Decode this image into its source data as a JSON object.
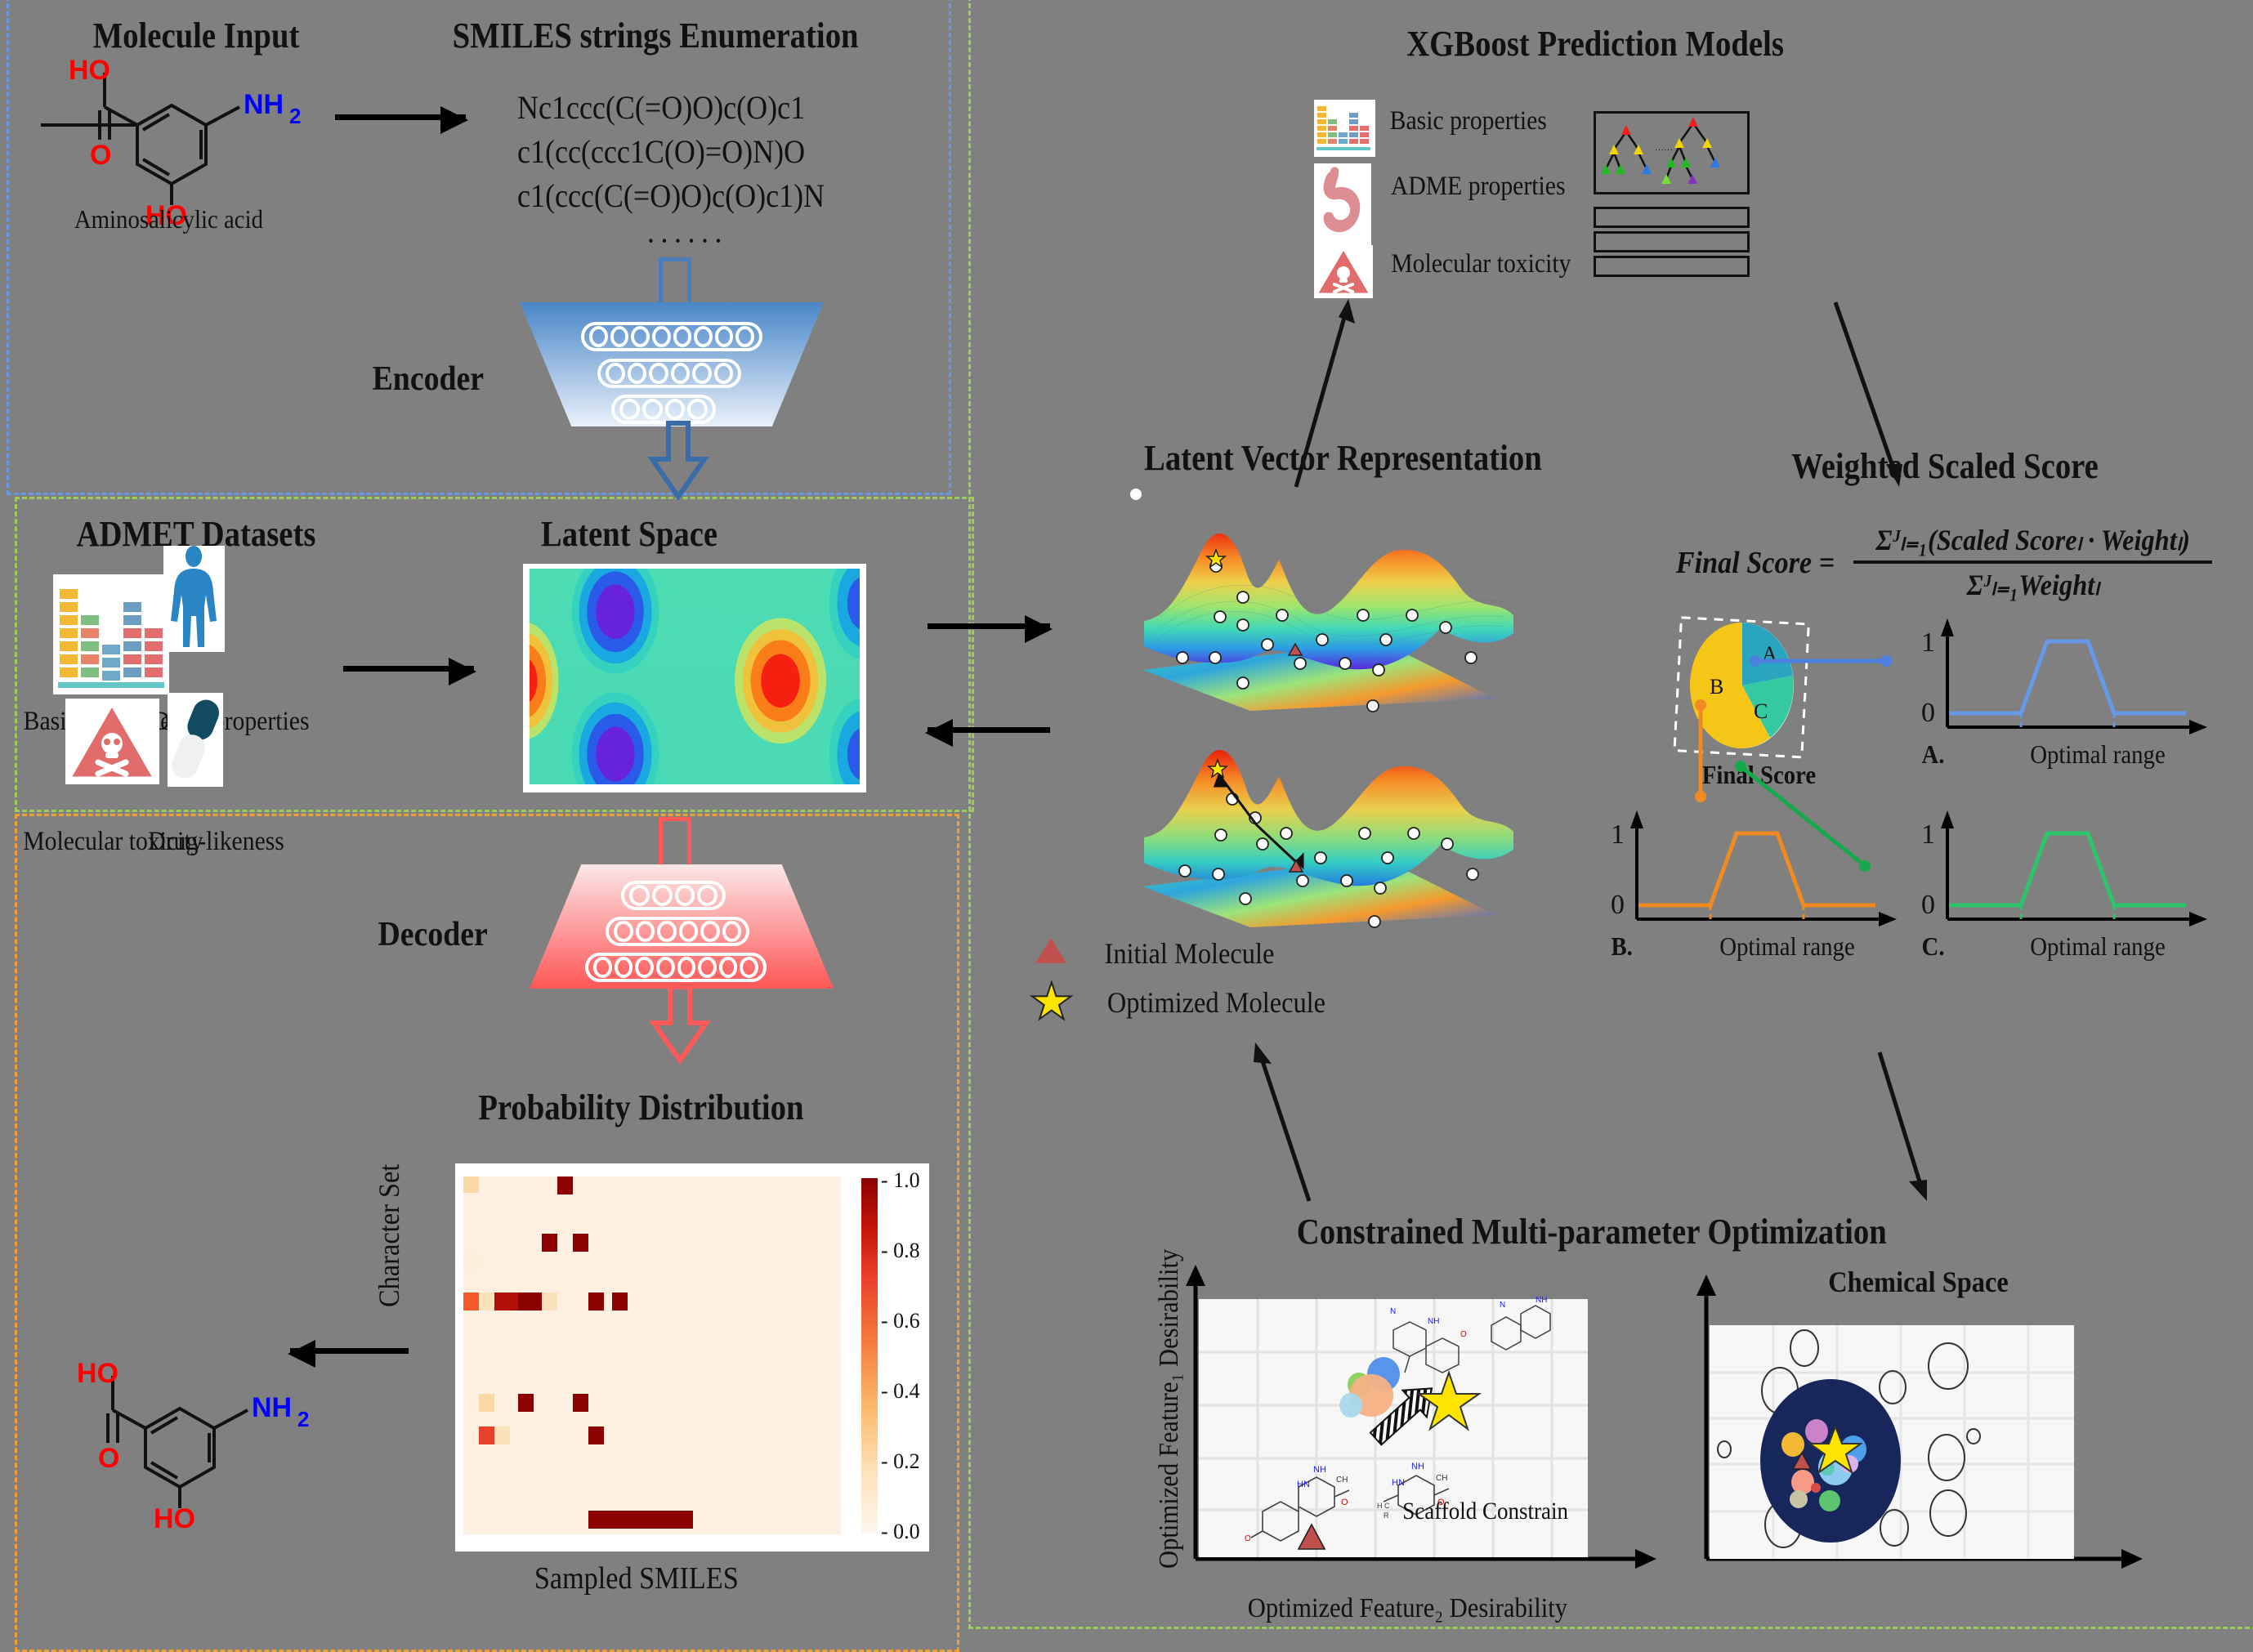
{
  "background_color": "#808080",
  "panels": {
    "molecule_input": {
      "title": "Molecule Input",
      "molecule_name": "Aminosalicylic acid",
      "atom_labels": [
        "HO",
        "O",
        "HO",
        "NH2"
      ],
      "border_color": "#6699e8"
    },
    "smiles_enumeration": {
      "title": "SMILES strings Enumeration",
      "strings": [
        "Nc1ccc(C(=O)O)c(O)c1",
        "c1(cc(ccc1C(O)=O)N)O",
        "c1(ccc(C(=O)O)c(O)c1)N"
      ],
      "ellipsis": "······"
    },
    "encoder": {
      "label": "Encoder",
      "layer_sizes": [
        8,
        6,
        4
      ],
      "color": "#4a7ebb"
    },
    "admet_datasets": {
      "title": "ADMET Datasets",
      "items": [
        {
          "label": "Basic properties",
          "icon": "bar-chart-icon"
        },
        {
          "label": "ADME properties",
          "icon": "human-body-icon"
        },
        {
          "label": "Molecular toxicity",
          "icon": "toxic-hazard-icon"
        },
        {
          "label": "Drug-likeness",
          "icon": "capsule-pill-icon"
        }
      ],
      "border_color": "#9acd5a"
    },
    "latent_space": {
      "title": "Latent Space"
    },
    "decoder": {
      "label": "Decoder",
      "layer_sizes": [
        4,
        6,
        8
      ],
      "color": "#ff5a5a",
      "border_color": "#f0a030"
    },
    "probability_distribution": {
      "title": "Probability Distribution",
      "ylabel": "Character Set",
      "xlabel": "Sampled SMILES"
    },
    "latent_vector": {
      "title": "Latent Vector Representation",
      "legend": [
        {
          "symbol": "triangle",
          "label": "Initial Molecule",
          "color": "#c0504d"
        },
        {
          "symbol": "star",
          "label": "Optimized Molecule",
          "color": "#ffe400"
        }
      ]
    },
    "xgboost": {
      "title": "XGBoost Prediction Models",
      "items": [
        {
          "label": "Basic properties",
          "icon": "bar-chart-icon"
        },
        {
          "label": "ADME properties",
          "icon": "stomach-icon"
        },
        {
          "label": "Molecular toxicity",
          "icon": "toxic-hazard-icon"
        }
      ],
      "tree_ellipsis": "······"
    },
    "weighted_scaled_score": {
      "title": "Weighted Scaled Score",
      "formula_lhs": "Final Score =",
      "formula_numerator": "Σᴶₗ₌₁(Scaled Scoreₗ · Weightₗ)",
      "formula_denominator": "Σᴶₗ₌₁Weightₗ",
      "pie_label": "Final Score",
      "pie_slices": [
        {
          "name": "A",
          "color": "#2aa5c0",
          "value": 25
        },
        {
          "name": "B",
          "color": "#f5c518",
          "value": 50
        },
        {
          "name": "C",
          "color": "#35c9a2",
          "value": 25
        }
      ],
      "subplots": [
        {
          "id": "A.",
          "xlabel": "Optimal range",
          "ytop": "1",
          "ybottom": "0",
          "color": "#6699e8"
        },
        {
          "id": "B.",
          "xlabel": "Optimal range",
          "ytop": "1",
          "ybottom": "0",
          "color": "#f08a22"
        },
        {
          "id": "C.",
          "xlabel": "Optimal range",
          "ytop": "1",
          "ybottom": "0",
          "color": "#2ec46a"
        }
      ]
    },
    "cmpo": {
      "title": "Constrained Multi-parameter Optimization",
      "left_plot": {
        "ylabel": "Optimized Feature₁  Desirability",
        "xlabel": "Optimized Feature₂  Desirability",
        "annotation": "Scaffold Constrain"
      },
      "right_plot": {
        "title": "Chemical  Space"
      },
      "border_color": "#9acd5a"
    }
  },
  "chart_data": [
    {
      "type": "heatmap",
      "title": "Probability Distribution",
      "xlabel": "Sampled SMILES",
      "ylabel": "Character Set",
      "colorbar_ticks": [
        "1.0",
        "0.8",
        "0.6",
        "0.4",
        "0.2",
        "0.0"
      ],
      "colorbar_range": [
        0.0,
        1.0
      ],
      "colormap": "OrRd",
      "cells": [
        {
          "col": 0,
          "row": 0,
          "value": 0.35
        },
        {
          "col": 6,
          "row": 0,
          "value": 1.0
        },
        {
          "col": 5,
          "row": 3,
          "value": 1.0
        },
        {
          "col": 7,
          "row": 3,
          "value": 1.0
        },
        {
          "col": 0,
          "row": 4,
          "value": 0.15
        },
        {
          "col": 0,
          "row": 7,
          "value": 0.62
        },
        {
          "col": 1,
          "row": 7,
          "value": 0.2
        },
        {
          "col": 2,
          "row": 7,
          "value": 0.93
        },
        {
          "col": 3,
          "row": 7,
          "value": 1.0
        },
        {
          "col": 4,
          "row": 7,
          "value": 0.22
        },
        {
          "col": 8,
          "row": 7,
          "value": 1.0
        },
        {
          "col": 10,
          "row": 7,
          "value": 1.0
        },
        {
          "col": 1,
          "row": 12,
          "value": 0.3
        },
        {
          "col": 4,
          "row": 12,
          "value": 1.0
        },
        {
          "col": 9,
          "row": 12,
          "value": 1.0
        },
        {
          "col": 1,
          "row": 14,
          "value": 0.7
        },
        {
          "col": 2,
          "row": 14,
          "value": 0.25
        },
        {
          "col": 11,
          "row": 14,
          "value": 1.0
        },
        {
          "col": 11,
          "row": 18,
          "value": 1.0
        }
      ]
    },
    {
      "type": "pie",
      "title": "Final Score",
      "labels": [
        "A",
        "B",
        "C"
      ],
      "values": [
        25,
        50,
        25
      ],
      "colors": [
        "#2aa5c0",
        "#f5c518",
        "#35c9a2"
      ]
    },
    {
      "type": "line",
      "title": "A.",
      "xlabel": "Optimal range",
      "ylabel": "",
      "ytick_labels": [
        "0",
        "1"
      ],
      "ylim": [
        0,
        1
      ],
      "color": "#6699e8",
      "x": [
        0.0,
        0.28,
        0.42,
        0.72,
        0.86,
        1.0
      ],
      "y": [
        0,
        0,
        1,
        1,
        0,
        0
      ]
    },
    {
      "type": "line",
      "title": "B.",
      "xlabel": "Optimal range",
      "ylabel": "",
      "ytick_labels": [
        "0",
        "1"
      ],
      "ylim": [
        0,
        1
      ],
      "color": "#f08a22",
      "x": [
        0.0,
        0.28,
        0.4,
        0.7,
        0.8,
        1.0
      ],
      "y": [
        0,
        0,
        1,
        1,
        0,
        0
      ]
    },
    {
      "type": "line",
      "title": "C.",
      "xlabel": "Optimal range",
      "ylabel": "",
      "ytick_labels": [
        "0",
        "1"
      ],
      "ylim": [
        0,
        1
      ],
      "color": "#2ec46a",
      "x": [
        0.0,
        0.3,
        0.42,
        0.72,
        0.82,
        1.0
      ],
      "y": [
        0,
        0,
        1,
        1,
        0,
        0
      ]
    },
    {
      "type": "scatter",
      "title": "Constrained Multi-parameter Optimization",
      "xlabel": "Optimized Feature₂  Desirability",
      "ylabel": "Optimized Feature₁  Desirability",
      "annotation": "Scaffold Constrain",
      "points": [
        {
          "x": 0.27,
          "y": 0.1,
          "marker": "triangle",
          "color": "#c0504d",
          "label": "Initial Molecule"
        },
        {
          "x": 0.41,
          "y": 0.46,
          "marker": "circle",
          "color": "#8ad05a",
          "size": 18
        },
        {
          "x": 0.52,
          "y": 0.5,
          "marker": "circle",
          "color": "#4d8fe8",
          "size": 26
        },
        {
          "x": 0.46,
          "y": 0.4,
          "marker": "circle",
          "color": "#f5b183",
          "size": 34
        },
        {
          "x": 0.41,
          "y": 0.35,
          "marker": "circle",
          "color": "#a9d9ec",
          "size": 18
        },
        {
          "x": 0.66,
          "y": 0.63,
          "marker": "star",
          "color": "#ffe400",
          "label": "Optimized Molecule"
        }
      ]
    },
    {
      "type": "scatter",
      "title": "Chemical  Space",
      "points": [
        {
          "x": 0.3,
          "y": 0.88,
          "marker": "open-circle"
        },
        {
          "x": 0.82,
          "y": 0.8,
          "marker": "open-circle"
        },
        {
          "x": 0.14,
          "y": 0.68,
          "marker": "open-circle"
        },
        {
          "x": 0.62,
          "y": 0.68,
          "marker": "open-circle"
        },
        {
          "x": 0.84,
          "y": 0.48,
          "marker": "open-circle"
        },
        {
          "x": 0.04,
          "y": 0.42,
          "marker": "open-circle"
        },
        {
          "x": 0.64,
          "y": 0.38,
          "marker": "open-circle"
        },
        {
          "x": 0.18,
          "y": 0.12,
          "marker": "open-circle"
        },
        {
          "x": 0.58,
          "y": 0.1,
          "marker": "open-circle"
        },
        {
          "x": 0.82,
          "y": 0.14,
          "marker": "open-circle"
        },
        {
          "x": 0.42,
          "y": 0.45,
          "marker": "cluster",
          "color": "#17275c"
        },
        {
          "x": 0.38,
          "y": 0.42,
          "marker": "triangle",
          "color": "#c0504d"
        },
        {
          "x": 0.47,
          "y": 0.55,
          "marker": "star",
          "color": "#ffe400"
        }
      ]
    }
  ]
}
